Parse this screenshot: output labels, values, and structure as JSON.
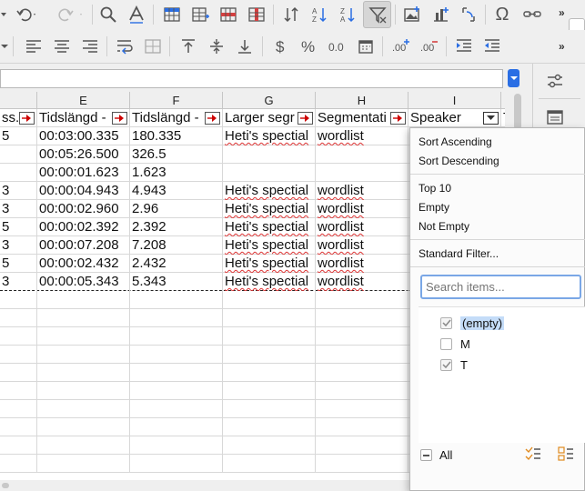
{
  "columns": [
    {
      "letter": "",
      "header": "ss.r"
    },
    {
      "letter": "E",
      "header": "Tidslängd -"
    },
    {
      "letter": "F",
      "header": "Tidslängd -"
    },
    {
      "letter": "G",
      "header": "Larger segr"
    },
    {
      "letter": "H",
      "header": "Segmentati"
    },
    {
      "letter": "I",
      "header": "Speaker"
    },
    {
      "letter": "",
      "header": "T"
    }
  ],
  "rows": [
    {
      "d": "5",
      "e": "00:03:00.335",
      "f": "180.335",
      "g": "Heti's spectial",
      "h": "wordlist"
    },
    {
      "d": "",
      "e": "00:05:26.500",
      "f": "326.5",
      "g": "",
      "h": ""
    },
    {
      "d": "",
      "e": "00:00:01.623",
      "f": "1.623",
      "g": "",
      "h": ""
    },
    {
      "d": "3",
      "e": "00:00:04.943",
      "f": "4.943",
      "g": "Heti's spectial",
      "h": "wordlist"
    },
    {
      "d": "3",
      "e": "00:00:02.960",
      "f": "2.96",
      "g": "Heti's spectial",
      "h": "wordlist"
    },
    {
      "d": "5",
      "e": "00:00:02.392",
      "f": "2.392",
      "g": "Heti's spectial",
      "h": "wordlist"
    },
    {
      "d": "3",
      "e": "00:00:07.208",
      "f": "7.208",
      "g": "Heti's spectial",
      "h": "wordlist"
    },
    {
      "d": "5",
      "e": "00:00:02.432",
      "f": "2.432",
      "g": "Heti's spectial",
      "h": "wordlist"
    },
    {
      "d": "3",
      "e": "00:00:05.343",
      "f": "5.343",
      "g": "Heti's spectial",
      "h": "wordlist"
    }
  ],
  "filter_popup": {
    "sort_ascending": "Sort Ascending",
    "sort_descending": "Sort Descending",
    "top10": "Top 10",
    "empty": "Empty",
    "not_empty": "Not Empty",
    "standard_filter": "Standard Filter...",
    "search_placeholder": "Search items...",
    "values": [
      {
        "label": "(empty)",
        "checked": true,
        "selected": true
      },
      {
        "label": "M",
        "checked": false,
        "selected": false
      },
      {
        "label": "T",
        "checked": true,
        "selected": false
      }
    ],
    "all_label": "All"
  },
  "toolbar": {
    "omega": "Ω",
    "more": "»"
  },
  "colors": {
    "accent": "#2a6ee4",
    "selection": "#c4dcf8",
    "spell_underline": "#d33333"
  }
}
